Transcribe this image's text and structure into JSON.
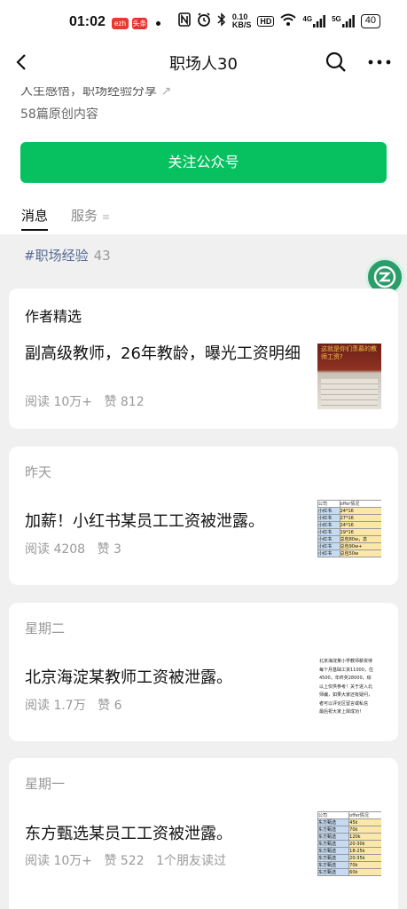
{
  "status_bar": {
    "time": "01:02",
    "badge1": "ezh",
    "badge2": "头条",
    "net_speed_top": "0.10",
    "net_speed_bottom": "KB/S",
    "hd": "HD",
    "sig1": "4G",
    "sig2": "5G",
    "battery": "40"
  },
  "nav": {
    "title": "职场人30"
  },
  "header": {
    "intro": "人生感悟，职场经验分享",
    "post_count": "58篇原创内容",
    "follow_label": "关注公众号",
    "tabs": [
      "消息",
      "服务"
    ]
  },
  "tag": {
    "name": "#职场经验",
    "count": "43"
  },
  "featured": {
    "heading": "作者精选",
    "title": "副高级教师，26年教龄，曝光工资明细",
    "meta": [
      "阅读 10万+",
      "赞 812"
    ],
    "thumb_caption": "这就是你们羡慕的教师工资?"
  },
  "articles": [
    {
      "date": "昨天",
      "title": "加薪！小红书某员工工资被泄露。",
      "meta": [
        "阅读 4208",
        "赞 3"
      ],
      "thumb_header": [
        "公司",
        "offer情况"
      ],
      "thumb_rows": [
        [
          "小红书",
          "24*16"
        ],
        [
          "小红书",
          "27*16"
        ],
        [
          "小红书",
          "24*16"
        ],
        [
          "小红书",
          "19*16"
        ],
        [
          "小红书",
          "总包80w，息"
        ],
        [
          "小红书",
          "总包90w+"
        ],
        [
          "小红书",
          "总包50w"
        ]
      ]
    },
    {
      "date": "星期二",
      "title": "北京海淀某教师工资被泄露。",
      "meta": [
        "阅读 1.7万",
        "赞 6"
      ],
      "thumb_lines": [
        "北京海淀某小学教师薪资待",
        "每个月基础工资11000，住",
        "4500，年终奖28000，综",
        "以上仅供参考！关于进入北",
        "师编，如果大家还有疑问，",
        "者可以评论区留言或私信",
        "最后祝大家上岸成功！"
      ]
    },
    {
      "date": "星期一",
      "title": "东方甄选某员工工资被泄露。",
      "meta": [
        "阅读 10万+",
        "赞 522",
        "1个朋友读过"
      ],
      "thumb_header": [
        "公司",
        "offer情况"
      ],
      "thumb_rows": [
        [
          "东方甄选",
          "45k"
        ],
        [
          "东方甄选",
          "70k"
        ],
        [
          "东方甄选",
          "120k"
        ],
        [
          "东方甄选",
          "20-30k"
        ],
        [
          "东方甄选",
          "18-25k"
        ],
        [
          "东方甄选",
          "20-35k"
        ],
        [
          "东方甄选",
          "70k"
        ],
        [
          "东方甄选",
          "60k"
        ]
      ]
    }
  ],
  "colors": {
    "accent": "#07c160",
    "link": "#576b95",
    "float": "#2a9d6b"
  }
}
